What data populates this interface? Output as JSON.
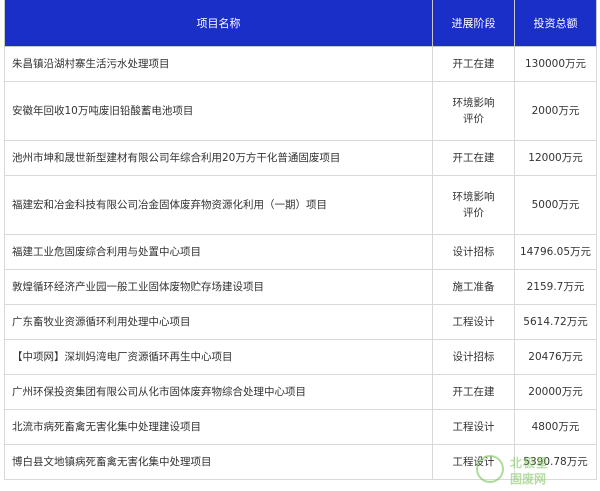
{
  "table": {
    "headers": [
      "项目名称",
      "进展阶段",
      "投资总额"
    ],
    "rows": [
      {
        "name": "朱昌镇沿湖村寨生活污水处理项目",
        "stage": [
          "开工在建"
        ],
        "amount": "130000万元"
      },
      {
        "name": "安徽年回收10万吨废旧铅酸蓄电池项目",
        "stage": [
          "环境影响",
          "评价"
        ],
        "amount": "2000万元"
      },
      {
        "name": "池州市坤和晟世新型建材有限公司年综合利用20万方干化普通固废项目",
        "stage": [
          "开工在建"
        ],
        "amount": "12000万元"
      },
      {
        "name": "福建宏和冶金科技有限公司冶金固体废弃物资源化利用（一期）项目",
        "stage": [
          "环境影响",
          "评价"
        ],
        "amount": "5000万元"
      },
      {
        "name": "福建工业危固废综合利用与处置中心项目",
        "stage": [
          "设计招标"
        ],
        "amount": "14796.05万元"
      },
      {
        "name": "敦煌循环经济产业园一般工业固体废物贮存场建设项目",
        "stage": [
          "施工准备"
        ],
        "amount": "2159.7万元"
      },
      {
        "name": "广东畜牧业资源循环利用处理中心项目",
        "stage": [
          "工程设计"
        ],
        "amount": "5614.72万元"
      },
      {
        "name": "【中项网】深圳妈湾电厂资源循环再生中心项目",
        "stage": [
          "设计招标"
        ],
        "amount": "20476万元"
      },
      {
        "name": "广州环保投资集团有限公司从化市固体废弃物综合处理中心项目",
        "stage": [
          "开工在建"
        ],
        "amount": "20000万元"
      },
      {
        "name": "北流市病死畜禽无害化集中处理建设项目",
        "stage": [
          "工程设计"
        ],
        "amount": "4800万元"
      },
      {
        "name": "博白县文地镇病死畜禽无害化集中处理项目",
        "stage": [
          "工程设计"
        ],
        "amount": "5390.78万元"
      }
    ]
  },
  "watermark": {
    "line1": "北极星",
    "line2": "固废网"
  },
  "colors": {
    "header_bg": "#1a2ec8",
    "header_text": "#ffffff",
    "border": "#d9d9d9",
    "watermark": "#7cc35a"
  }
}
